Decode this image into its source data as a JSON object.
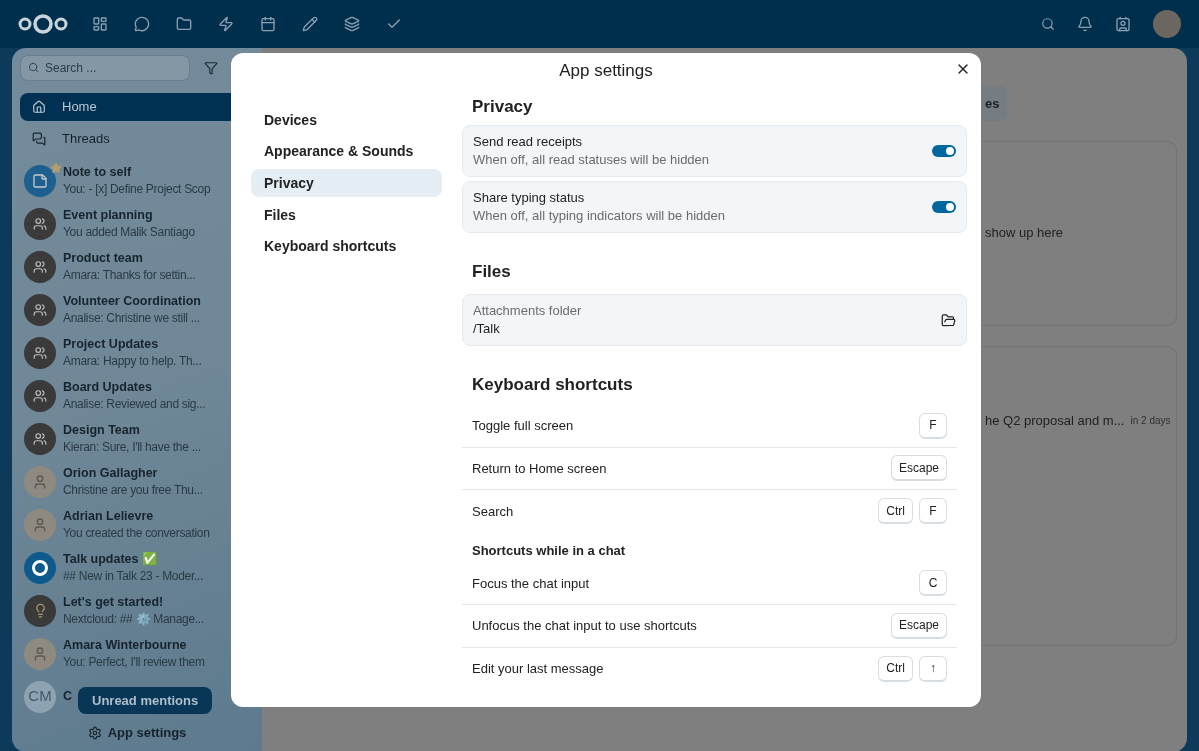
{
  "sidebar": {
    "search": {
      "placeholder": "Search ..."
    },
    "nav": [
      {
        "label": "Home",
        "selected": true
      },
      {
        "label": "Threads",
        "selected": false
      }
    ],
    "conversations": [
      {
        "title": "Note to self",
        "subtitle": "You: - [x] Define Project Scop",
        "kind": "note",
        "favorite": true
      },
      {
        "title": "Event planning",
        "subtitle": "You added Malik Santiago",
        "kind": "group",
        "favorite": false
      },
      {
        "title": "Product team",
        "subtitle": "Amara: Thanks for settin...",
        "kind": "group",
        "favorite": false
      },
      {
        "title": "Volunteer Coordination",
        "subtitle": "Analise: Christine we still ...",
        "kind": "group",
        "favorite": false
      },
      {
        "title": "Project Updates",
        "subtitle": "Amara: Happy to help. Th...",
        "kind": "group",
        "favorite": false
      },
      {
        "title": "Board Updates",
        "subtitle": "Analise: Reviewed and sig...",
        "kind": "group",
        "favorite": false
      },
      {
        "title": "Design Team",
        "subtitle": "Kieran: Sure, I'll have the ...",
        "kind": "group",
        "favorite": false
      },
      {
        "title": "Orion Gallagher",
        "subtitle": "Christine are you free Thu...",
        "kind": "person",
        "favorite": false
      },
      {
        "title": "Adrian Lelievre",
        "subtitle": "You created the conversation",
        "kind": "person",
        "favorite": false
      },
      {
        "title": "Talk updates ✅",
        "subtitle": "## New in Talk 23 - Moder...",
        "kind": "talk",
        "favorite": false
      },
      {
        "title": "Let's get started!",
        "subtitle": "Nextcloud: ## ⚙️ Manage...",
        "kind": "bulb",
        "favorite": false
      },
      {
        "title": "Amara Winterbourne",
        "subtitle": "You: Perfect, I'll review them",
        "kind": "person",
        "favorite": false
      },
      {
        "title": "C",
        "initials": "CM",
        "kind": "initials",
        "favorite": false
      }
    ],
    "unread_button": "Unread mentions",
    "settings_button": "App settings"
  },
  "main": {
    "button": "es",
    "cards": [
      {
        "text": "show up here"
      },
      {
        "text": "he Q2 proposal and m...",
        "meta": "in 2 days"
      }
    ]
  },
  "dialog": {
    "title": "App settings",
    "nav": [
      {
        "label": "Devices",
        "selected": false
      },
      {
        "label": "Appearance & Sounds",
        "selected": false
      },
      {
        "label": "Privacy",
        "selected": true
      },
      {
        "label": "Files",
        "selected": false
      },
      {
        "label": "Keyboard shortcuts",
        "selected": false
      }
    ],
    "privacy": {
      "heading": "Privacy",
      "toggles": [
        {
          "label": "Send read receipts",
          "description": "When off, all read statuses will be hidden",
          "on": true
        },
        {
          "label": "Share typing status",
          "description": "When off, all typing indicators will be hidden",
          "on": true
        }
      ]
    },
    "files": {
      "heading": "Files",
      "field": {
        "label": "Attachments folder",
        "value": "/Talk"
      }
    },
    "shortcuts": {
      "heading": "Keyboard shortcuts",
      "items": [
        {
          "kind": "shortcut",
          "label": "Toggle full screen",
          "keys": [
            "F"
          ]
        },
        {
          "kind": "shortcut",
          "label": "Return to Home screen",
          "keys": [
            "Escape"
          ]
        },
        {
          "kind": "shortcut",
          "label": "Search",
          "keys": [
            "Ctrl",
            "F"
          ]
        },
        {
          "kind": "subheading",
          "label": "Shortcuts while in a chat"
        },
        {
          "kind": "shortcut",
          "label": "Focus the chat input",
          "keys": [
            "C"
          ]
        },
        {
          "kind": "shortcut",
          "label": "Unfocus the chat input to use shortcuts",
          "keys": [
            "Escape"
          ]
        },
        {
          "kind": "shortcut",
          "label": "Edit your last message",
          "keys": [
            "Ctrl",
            "↑"
          ]
        }
      ]
    }
  }
}
